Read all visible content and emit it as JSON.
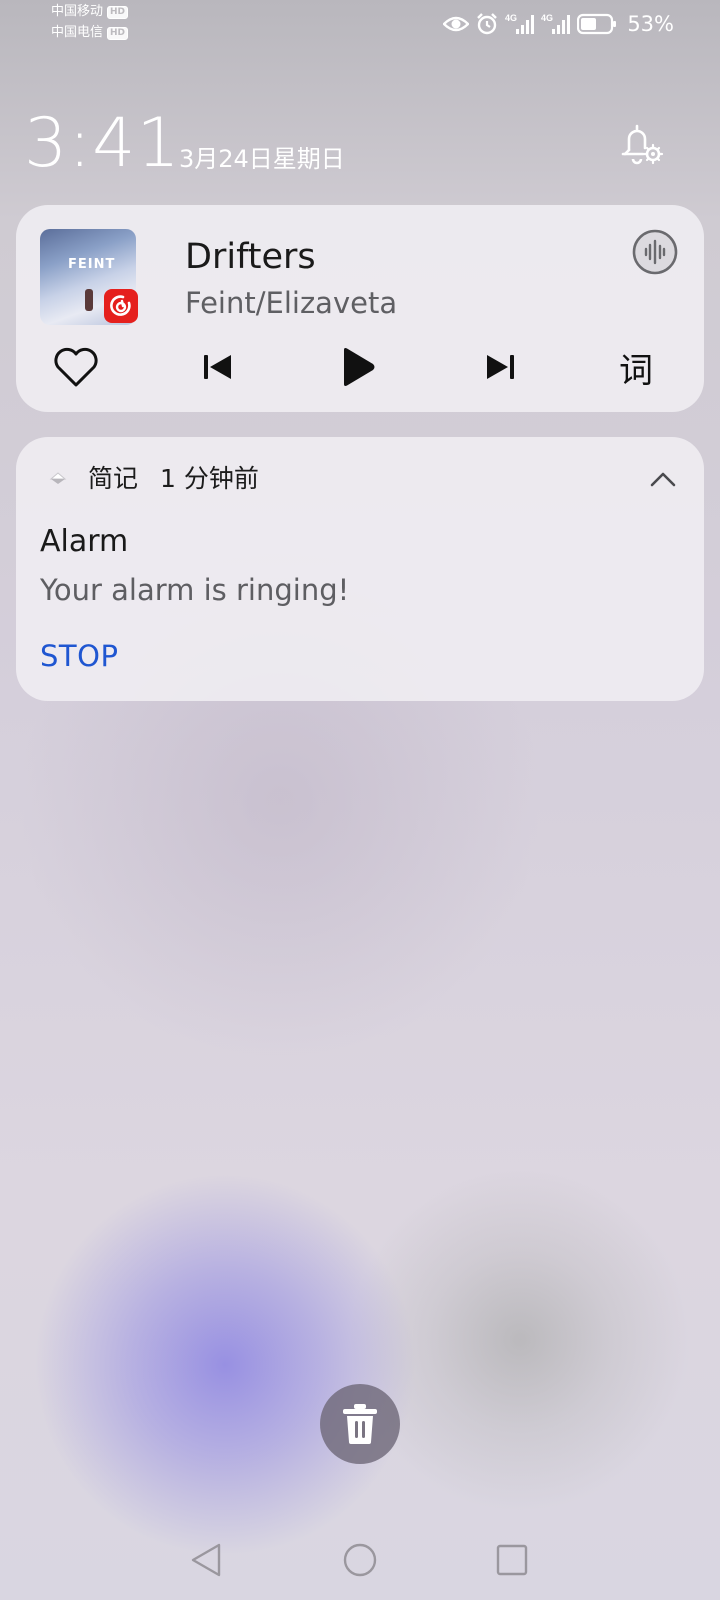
{
  "status_bar": {
    "carrier_1": "中国移动",
    "carrier_2": "中国电信",
    "hd_badge": "HD",
    "network_1": "4G",
    "network_2": "4G",
    "battery_percent": "53%",
    "battery_level": 0.53,
    "icons": [
      "eye-comfort-icon",
      "alarm-icon",
      "signal-icon",
      "signal-icon",
      "battery-icon"
    ]
  },
  "lockscreen": {
    "time": "3:41",
    "date": "3月24日星期日"
  },
  "media": {
    "title": "Drifters",
    "artist": "Feint/Elizaveta",
    "album_art_text": "FEINT",
    "lyrics_label": "词",
    "app_badge_color": "#e5201d",
    "controls": [
      "like-icon",
      "previous-icon",
      "play-icon",
      "next-icon",
      "lyrics-button"
    ]
  },
  "notification": {
    "app_name": "简记",
    "time_ago": "1 分钟前",
    "title": "Alarm",
    "body": "Your alarm is ringing!",
    "action": "STOP",
    "action_color": "#1f56d1"
  },
  "colors": {
    "accent_blue": "#1f56d1",
    "card_bg": "#f0eef3",
    "netease_red": "#e5201d"
  }
}
